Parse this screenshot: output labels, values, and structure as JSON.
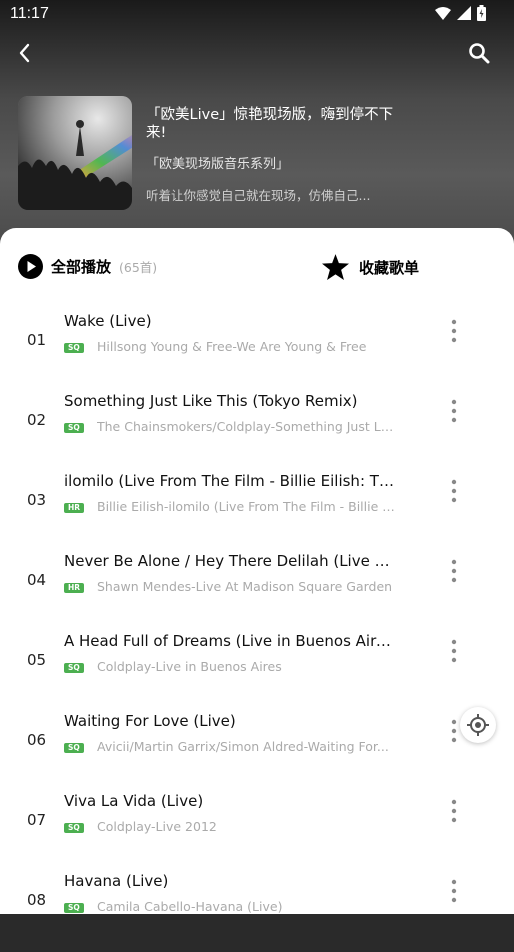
{
  "status_bar": {
    "time": "11:17"
  },
  "playlist": {
    "title": "「欧美Live」惊艳现场版，嗨到停不下来!",
    "series": "「欧美现场版音乐系列」",
    "description": "听着让你感觉自己就在现场，仿佛自己..."
  },
  "actions": {
    "play_all_label": "全部播放",
    "song_count": "(65首)",
    "favorite_label": "收藏歌单"
  },
  "colors": {
    "quality_badge": "#4caf50",
    "sheet_bg": "#ffffff"
  },
  "icons": [
    "back-icon",
    "search-icon",
    "play-circle-icon",
    "star-icon",
    "more-vertical-icon",
    "locate-icon"
  ],
  "songs": [
    {
      "num": "01",
      "title": "Wake (Live)",
      "quality": "SQ",
      "subtitle": "Hillsong Young & Free-We Are Young & Free"
    },
    {
      "num": "02",
      "title": "Something Just Like This (Tokyo Remix)",
      "quality": "SQ",
      "subtitle": "The Chainsmokers/Coldplay-Something Just Li..."
    },
    {
      "num": "03",
      "title": "ilomilo (Live From The Film - Billie Eilish: The...",
      "quality": "HR",
      "subtitle": "Billie Eilish-ilomilo (Live From The Film - Billie E..."
    },
    {
      "num": "04",
      "title": "Never Be Alone / Hey There Delilah (Live At...",
      "quality": "HR",
      "subtitle": "Shawn Mendes-Live At Madison Square Garden"
    },
    {
      "num": "05",
      "title": "A Head Full of Dreams (Live in Buenos Aires)",
      "quality": "SQ",
      "subtitle": "Coldplay-Live in Buenos Aires"
    },
    {
      "num": "06",
      "title": "Waiting For Love (Live)",
      "quality": "SQ",
      "subtitle": "Avicii/Martin Garrix/Simon Aldred-Waiting For..."
    },
    {
      "num": "07",
      "title": "Viva La Vida (Live)",
      "quality": "SQ",
      "subtitle": "Coldplay-Live 2012"
    },
    {
      "num": "08",
      "title": "Havana (Live)",
      "quality": "SQ",
      "subtitle": "Camila Cabello-Havana (Live)"
    }
  ]
}
